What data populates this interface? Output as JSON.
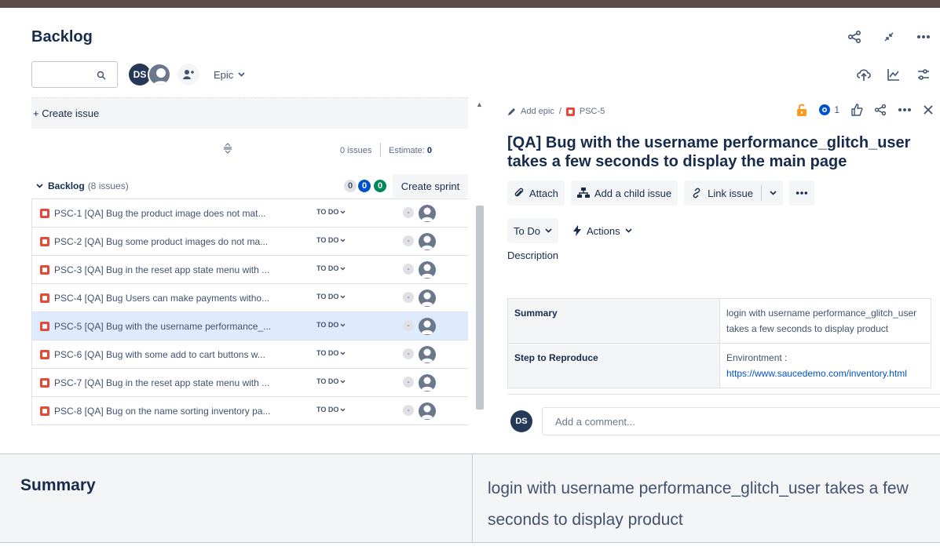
{
  "header": {
    "title": "Backlog",
    "epic_label": "Epic",
    "avatar_initials": "DS"
  },
  "left": {
    "create_issue": "+ Create issue",
    "issues_count": "0 issues",
    "estimate_label": "Estimate:",
    "estimate_value": "0",
    "backlog_title": "Backlog",
    "backlog_count": "(8 issues)",
    "pill_todo": "0",
    "pill_progress": "0",
    "pill_done": "0",
    "create_sprint": "Create sprint",
    "status_label": "TO DO",
    "rows": [
      {
        "text": "PSC-1 [QA] Bug the product image does not mat..."
      },
      {
        "text": "PSC-2 [QA] Bug some product images do not ma..."
      },
      {
        "text": "PSC-3 [QA] Bug in the reset app state menu with ..."
      },
      {
        "text": "PSC-4 [QA] Bug Users can make payments witho..."
      },
      {
        "text": "PSC-5 [QA] Bug with the username performance_..."
      },
      {
        "text": "PSC-6 [QA] Bug with some add to cart buttons w..."
      },
      {
        "text": "PSC-7 [QA] Bug in the reset app state menu with ..."
      },
      {
        "text": "PSC-8 [QA] Bug on the name sorting inventory pa..."
      }
    ]
  },
  "detail": {
    "add_epic": "Add epic",
    "issue_key": "PSC-5",
    "watch_count": "1",
    "title": "[QA] Bug with the username performance_glitch_user takes a few seconds to display the main page",
    "attach": "Attach",
    "add_child": "Add a child issue",
    "link_issue": "Link issue",
    "status": "To Do",
    "actions": "Actions",
    "description_label": "Description",
    "table": {
      "summary_label": "Summary",
      "summary_value": "login with username performance_glitch_user takes a few seconds to display product",
      "steps_label": "Step to Reproduce",
      "env_label": "Environtment :",
      "env_link": "https://www.saucedemo.com/inventory.html"
    },
    "comment_avatar": "DS",
    "comment_placeholder": "Add a comment..."
  },
  "zoom": {
    "label": "Summary",
    "value": "login with username performance_glitch_user takes a few seconds to display product"
  }
}
